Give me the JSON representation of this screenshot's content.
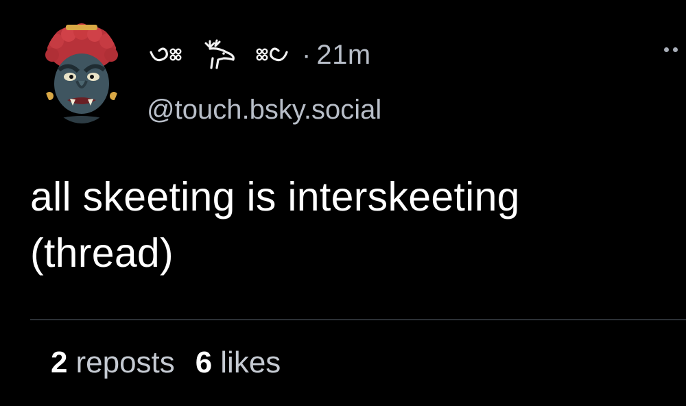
{
  "author": {
    "display_name_glyphs": [
      "ornament-left-icon",
      "deer-icon",
      "ornament-right-icon"
    ],
    "handle": "@touch.bsky.social",
    "avatar": "demon-mask-avatar"
  },
  "meta": {
    "separator": "·",
    "timestamp": "21m"
  },
  "post": {
    "text": "all skeeting is interskeeting (thread)"
  },
  "stats": {
    "reposts_count": "2",
    "reposts_label": "reposts",
    "likes_count": "6",
    "likes_label": "likes"
  },
  "colors": {
    "background": "#000000",
    "primary_text": "#ffffff",
    "secondary_text": "#b8bec8",
    "divider": "#2c3036"
  }
}
